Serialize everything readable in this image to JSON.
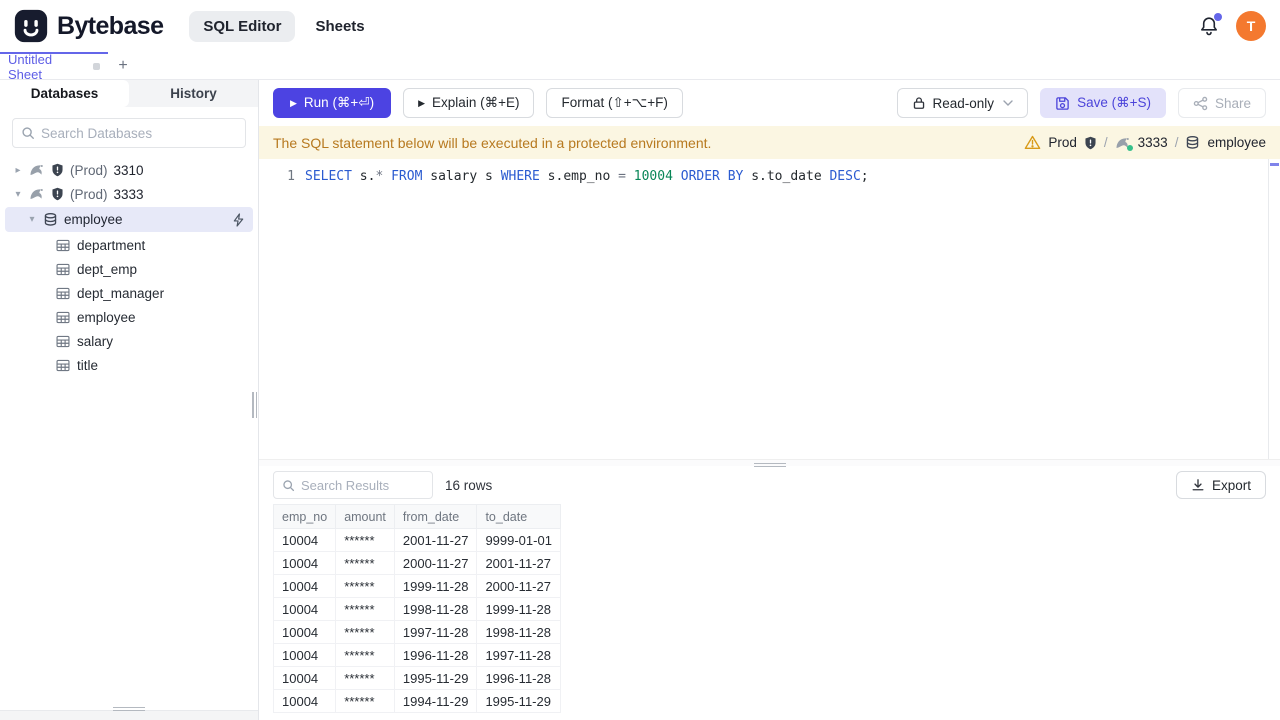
{
  "header": {
    "brand": "Bytebase",
    "nav": [
      {
        "label": "SQL Editor"
      },
      {
        "label": "Sheets"
      }
    ],
    "avatar_initial": "T"
  },
  "tabbar": {
    "active_tab": "Untitled Sheet",
    "add_label": "+"
  },
  "sidebar": {
    "tabs": [
      "Databases",
      "History"
    ],
    "search_placeholder": "Search Databases",
    "instances": [
      {
        "env": "(Prod)",
        "name": "3310"
      },
      {
        "env": "(Prod)",
        "name": "3333"
      }
    ],
    "selected_database": "employee",
    "tables": [
      "department",
      "dept_emp",
      "dept_manager",
      "employee",
      "salary",
      "title"
    ]
  },
  "toolbar": {
    "run": "Run (⌘+⏎)",
    "explain": "Explain (⌘+E)",
    "format": "Format (⇧+⌥+F)",
    "readonly": "Read-only",
    "save": "Save (⌘+S)",
    "share": "Share"
  },
  "banner": {
    "message": "The SQL statement below will be executed in a protected environment.",
    "environment": "Prod",
    "instance": "3333",
    "database": "employee",
    "separator": "/"
  },
  "editor": {
    "line_number": "1",
    "sql_text": "SELECT s.* FROM salary s WHERE s.emp_no = 10004 ORDER BY s.to_date DESC;",
    "tokens": [
      [
        "SELECT",
        "kw"
      ],
      [
        " s.",
        "id"
      ],
      [
        "*",
        "op"
      ],
      [
        " ",
        "pl"
      ],
      [
        "FROM",
        "kw"
      ],
      [
        " salary s ",
        "id"
      ],
      [
        "WHERE",
        "kw"
      ],
      [
        " s.emp_no ",
        "id"
      ],
      [
        "=",
        "op"
      ],
      [
        " ",
        "pl"
      ],
      [
        "10004",
        "num"
      ],
      [
        " ",
        "pl"
      ],
      [
        "ORDER",
        "kw"
      ],
      [
        " ",
        "pl"
      ],
      [
        "BY",
        "kw"
      ],
      [
        " s.to_date ",
        "id"
      ],
      [
        "DESC",
        "kw"
      ],
      [
        ";",
        "id"
      ]
    ]
  },
  "results": {
    "search_placeholder": "Search Results",
    "row_count": "16 rows",
    "export_label": "Export",
    "table": {
      "columns": [
        "emp_no",
        "amount",
        "from_date",
        "to_date"
      ],
      "rows": [
        [
          "10004",
          "******",
          "2001-11-27",
          "9999-01-01"
        ],
        [
          "10004",
          "******",
          "2000-11-27",
          "2001-11-27"
        ],
        [
          "10004",
          "******",
          "1999-11-28",
          "2000-11-27"
        ],
        [
          "10004",
          "******",
          "1998-11-28",
          "1999-11-28"
        ],
        [
          "10004",
          "******",
          "1997-11-28",
          "1998-11-28"
        ],
        [
          "10004",
          "******",
          "1996-11-28",
          "1997-11-28"
        ],
        [
          "10004",
          "******",
          "1995-11-29",
          "1996-11-28"
        ],
        [
          "10004",
          "******",
          "1994-11-29",
          "1995-11-29"
        ]
      ]
    }
  },
  "colors": {
    "accent": "#4c43e2",
    "warning_bg": "#fbf6e2",
    "warning_text": "#b7791f",
    "avatar_bg": "#f4792f",
    "selected_row_bg": "#e7e9f8"
  }
}
